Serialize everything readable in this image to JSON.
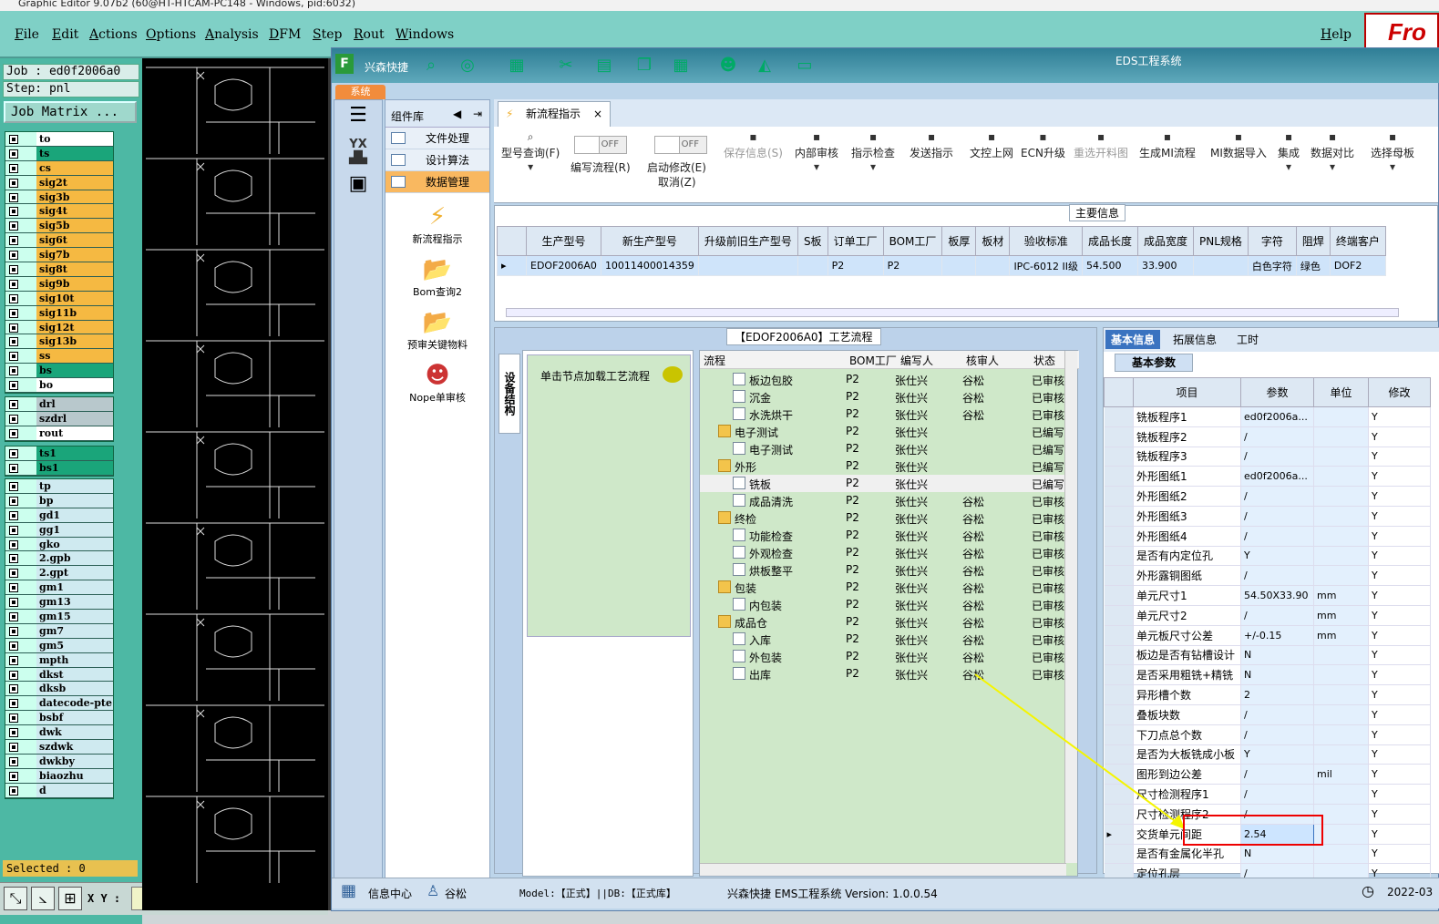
{
  "window_title": "Graphic Editor 9.07b2 (60@HT-HTCAM-PC148 - Windows, pid:6032)",
  "menu": [
    "File",
    "Edit",
    "Actions",
    "Options",
    "Analysis",
    "DFM",
    "Step",
    "Rout",
    "Windows"
  ],
  "help": "Help",
  "logo": "Fro",
  "job": "Job : ed0f2006a0",
  "step": "Step: pnl",
  "job_matrix": "Job Matrix ...",
  "layers_g1": [
    {
      "name": "to",
      "color": "#ffffff"
    },
    {
      "name": "ts",
      "color": "#1aa57a"
    },
    {
      "name": "cs",
      "color": "#f5b942"
    },
    {
      "name": "sig2t",
      "color": "#f5b942"
    },
    {
      "name": "sig3b",
      "color": "#f5b942"
    },
    {
      "name": "sig4t",
      "color": "#f5b942"
    },
    {
      "name": "sig5b",
      "color": "#f5b942"
    },
    {
      "name": "sig6t",
      "color": "#f5b942"
    },
    {
      "name": "sig7b",
      "color": "#f5b942"
    },
    {
      "name": "sig8t",
      "color": "#f5b942"
    },
    {
      "name": "sig9b",
      "color": "#f5b942"
    },
    {
      "name": "sig10t",
      "color": "#f5b942"
    },
    {
      "name": "sig11b",
      "color": "#f5b942"
    },
    {
      "name": "sig12t",
      "color": "#f5b942"
    },
    {
      "name": "sig13b",
      "color": "#f5b942"
    },
    {
      "name": "ss",
      "color": "#f5b942"
    },
    {
      "name": "bs",
      "color": "#1aa57a"
    },
    {
      "name": "bo",
      "color": "#ffffff"
    }
  ],
  "layers_g2": [
    {
      "name": "drl",
      "color": "#b8c8cc"
    },
    {
      "name": "szdrl",
      "color": "#b8c8cc"
    },
    {
      "name": "rout",
      "color": "#ffffff"
    }
  ],
  "layers_g3": [
    {
      "name": "ts1",
      "color": "#1aa57a"
    },
    {
      "name": "bs1",
      "color": "#1aa57a"
    }
  ],
  "layers_g4": [
    "tp",
    "bp",
    "gd1",
    "gg1",
    "gko",
    "2.gpb",
    "2.gpt",
    "gm1",
    "gm13",
    "gm15",
    "gm7",
    "gm5",
    "mpth",
    "dkst",
    "dksb",
    "datecode-pte",
    "bsbf",
    "dwk",
    "szdwk",
    "dwkby",
    "biaozhu",
    "d"
  ],
  "selected": "Selected : 0",
  "xy_label": "X Y :",
  "app": {
    "name": "兴森快捷",
    "title": "EDS工程系统",
    "sys_tab": "系统"
  },
  "comp": {
    "title": "组件库",
    "menus": [
      "文件处理",
      "设计算法",
      "数据管理"
    ],
    "items": [
      "新流程指示",
      "Bom查询2",
      "预审关键物料",
      "Nope单审核"
    ]
  },
  "tab": "新流程指示",
  "ribbon": {
    "query": "型号查询(F)",
    "edit_flow": "编写流程(R)",
    "start_mod": "启动修改(E)",
    "cancel": "取消(Z)",
    "toggle": "OFF",
    "buttons": [
      {
        "label": "保存信息(S)",
        "dis": true
      },
      {
        "label": "内部审核",
        "dis": false
      },
      {
        "label": "指示检查",
        "dis": false
      },
      {
        "label": "发送指示",
        "dis": false
      },
      {
        "label": "文控上网",
        "dis": false
      },
      {
        "label": "ECN升级",
        "dis": false
      },
      {
        "label": "重选开料图",
        "dis": true
      },
      {
        "label": "生成MI流程",
        "dis": false
      },
      {
        "label": "MI数据导入",
        "dis": false
      },
      {
        "label": "集成",
        "dis": false
      },
      {
        "label": "数据对比",
        "dis": false
      },
      {
        "label": "选择母板",
        "dis": false
      }
    ]
  },
  "main_title": "主要信息",
  "main_cols": [
    "生产型号",
    "新生产型号",
    "升级前旧生产型号",
    "S板",
    "订单工厂",
    "BOM工厂",
    "板厚",
    "板材",
    "验收标准",
    "成品长度",
    "成品宽度",
    "PNL规格",
    "字符",
    "阻焊",
    "终端客户"
  ],
  "main_row": [
    "EDOF2006A0",
    "10011400014359",
    "",
    "",
    "P2",
    "P2",
    "",
    "",
    "IPC-6012 II级",
    "54.500",
    "33.900",
    "",
    "白色字符",
    "绿色",
    "DOF2"
  ],
  "proc_title": "【EDOF2006A0】工艺流程",
  "side_tab": "设备结构",
  "hint": "单击节点加载工艺流程",
  "tree_cols": [
    "流程",
    "BOM工厂",
    "编写人",
    "核审人",
    "状态"
  ],
  "tree": [
    {
      "lvl": 2,
      "f": false,
      "n": "板边包胶",
      "b": "P2",
      "w": "张仕兴",
      "r": "谷松",
      "s": "已审核"
    },
    {
      "lvl": 2,
      "f": false,
      "n": "沉金",
      "b": "P2",
      "w": "张仕兴",
      "r": "谷松",
      "s": "已审核"
    },
    {
      "lvl": 2,
      "f": false,
      "n": "水洗烘干",
      "b": "P2",
      "w": "张仕兴",
      "r": "谷松",
      "s": "已审核"
    },
    {
      "lvl": 1,
      "f": true,
      "n": "电子测试",
      "b": "P2",
      "w": "张仕兴",
      "r": "",
      "s": "已编写"
    },
    {
      "lvl": 2,
      "f": false,
      "n": "电子测试",
      "b": "P2",
      "w": "张仕兴",
      "r": "",
      "s": "已编写"
    },
    {
      "lvl": 1,
      "f": true,
      "n": "外形",
      "b": "P2",
      "w": "张仕兴",
      "r": "",
      "s": "已编写"
    },
    {
      "lvl": 2,
      "f": false,
      "n": "铣板",
      "b": "P2",
      "w": "张仕兴",
      "r": "",
      "s": "已编写",
      "hl": true
    },
    {
      "lvl": 2,
      "f": false,
      "n": "成品清洗",
      "b": "P2",
      "w": "张仕兴",
      "r": "谷松",
      "s": "已审核"
    },
    {
      "lvl": 1,
      "f": true,
      "n": "终检",
      "b": "P2",
      "w": "张仕兴",
      "r": "谷松",
      "s": "已审核"
    },
    {
      "lvl": 2,
      "f": false,
      "n": "功能检查",
      "b": "P2",
      "w": "张仕兴",
      "r": "谷松",
      "s": "已审核"
    },
    {
      "lvl": 2,
      "f": false,
      "n": "外观检查",
      "b": "P2",
      "w": "张仕兴",
      "r": "谷松",
      "s": "已审核"
    },
    {
      "lvl": 2,
      "f": false,
      "n": "烘板整平",
      "b": "P2",
      "w": "张仕兴",
      "r": "谷松",
      "s": "已审核"
    },
    {
      "lvl": 1,
      "f": true,
      "n": "包装",
      "b": "P2",
      "w": "张仕兴",
      "r": "谷松",
      "s": "已审核"
    },
    {
      "lvl": 2,
      "f": false,
      "n": "内包装",
      "b": "P2",
      "w": "张仕兴",
      "r": "谷松",
      "s": "已审核"
    },
    {
      "lvl": 1,
      "f": true,
      "n": "成品仓",
      "b": "P2",
      "w": "张仕兴",
      "r": "谷松",
      "s": "已审核"
    },
    {
      "lvl": 2,
      "f": false,
      "n": "入库",
      "b": "P2",
      "w": "张仕兴",
      "r": "谷松",
      "s": "已审核"
    },
    {
      "lvl": 2,
      "f": false,
      "n": "外包装",
      "b": "P2",
      "w": "张仕兴",
      "r": "谷松",
      "s": "已审核"
    },
    {
      "lvl": 2,
      "f": false,
      "n": "出库",
      "b": "P2",
      "w": "张仕兴",
      "r": "谷松",
      "s": "已审核"
    }
  ],
  "ptabs": [
    "基本信息",
    "拓展信息",
    "工时"
  ],
  "basic_params": "基本参数",
  "pcols": [
    "项目",
    "参数",
    "单位",
    "修改"
  ],
  "params": [
    [
      "铣板程序1",
      "ed0f2006a...",
      "",
      "Y"
    ],
    [
      "铣板程序2",
      "/",
      "",
      "Y"
    ],
    [
      "铣板程序3",
      "/",
      "",
      "Y"
    ],
    [
      "外形图纸1",
      "ed0f2006a...",
      "",
      "Y"
    ],
    [
      "外形图纸2",
      "/",
      "",
      "Y"
    ],
    [
      "外形图纸3",
      "/",
      "",
      "Y"
    ],
    [
      "外形图纸4",
      "/",
      "",
      "Y"
    ],
    [
      "是否有内定位孔",
      "Y",
      "",
      "Y"
    ],
    [
      "外形露铜图纸",
      "/",
      "",
      "Y"
    ],
    [
      "单元尺寸1",
      "54.50X33.90",
      "mm",
      "Y"
    ],
    [
      "单元尺寸2",
      "/",
      "mm",
      "Y"
    ],
    [
      "单元板尺寸公差",
      "+/-0.15",
      "mm",
      "Y"
    ],
    [
      "板边是否有钻槽设计",
      "N",
      "",
      "Y"
    ],
    [
      "是否采用粗铣+精铣",
      "N",
      "",
      "Y"
    ],
    [
      "异形槽个数",
      "2",
      "",
      "Y"
    ],
    [
      "叠板块数",
      "/",
      "",
      "Y"
    ],
    [
      "下刀点总个数",
      "/",
      "",
      "Y"
    ],
    [
      "是否为大板铣成小板",
      "Y",
      "",
      "Y"
    ],
    [
      "图形到边公差",
      "/",
      "mil",
      "Y"
    ],
    [
      "尺寸检测程序1",
      "/",
      "",
      "Y"
    ],
    [
      "尺寸检测程序2",
      "/",
      "",
      "Y"
    ],
    [
      "交货单元间距",
      "2.54",
      "",
      "Y"
    ],
    [
      "是否有金属化半孔",
      "N",
      "",
      "Y"
    ],
    [
      "定位孔层",
      "/",
      "",
      "Y"
    ]
  ],
  "status": {
    "info": "信息中心",
    "user": "谷松",
    "model": "Model:【正式】||DB:【正式库】",
    "version": "兴森快捷 EMS工程系统 Version: 1.0.0.54",
    "date": "2022-03"
  }
}
